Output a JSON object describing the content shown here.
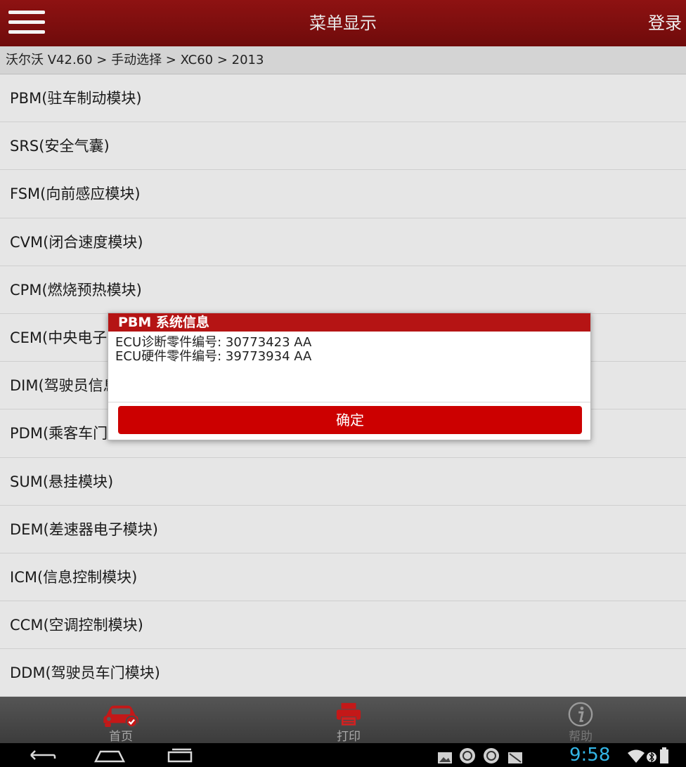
{
  "header": {
    "title": "菜单显示",
    "login": "登录"
  },
  "breadcrumb": "沃尔沃 V42.60 > 手动选择 > XC60 > 2013",
  "modules": [
    "PBM(驻车制动模块)",
    "SRS(安全气囊)",
    "FSM(向前感应模块)",
    "CVM(闭合速度模块)",
    "CPM(燃烧预热模块)",
    "CEM(中央电子模块)",
    "DIM(驾驶员信息模块)",
    "PDM(乘客车门模块)",
    "SUM(悬挂模块)",
    "DEM(差速器电子模块)",
    "ICM(信息控制模块)",
    "CCM(空调控制模块)",
    "DDM(驾驶员车门模块)"
  ],
  "dialog": {
    "title": "PBM 系统信息",
    "line1": "ECU诊断零件编号: 30773423 AA",
    "line2": "ECU硬件零件编号: 39773934 AA",
    "ok": "确定"
  },
  "bottom_nav": {
    "home": "首页",
    "print": "打印",
    "help": "帮助"
  },
  "status": {
    "time": "9:58"
  },
  "colors": {
    "header": "#7f0f0f",
    "accent": "#cc0000",
    "clock": "#33b5e5"
  }
}
